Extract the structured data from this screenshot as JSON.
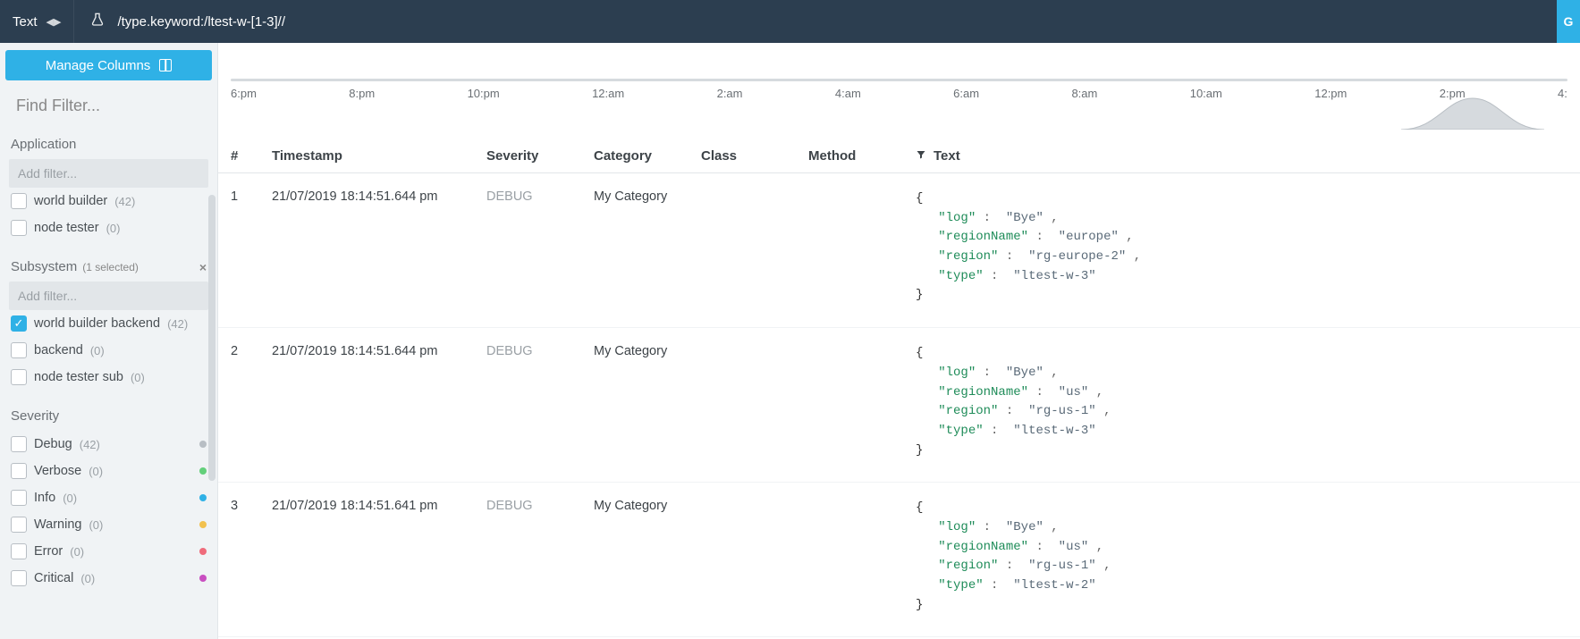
{
  "topbar": {
    "mode_label": "Text",
    "query": "/type.keyword:/ltest-w-[1-3]//",
    "right_btn": "G"
  },
  "sidebar": {
    "manage_columns": "Manage Columns",
    "find_filter_placeholder": "Find Filter...",
    "groups": {
      "application": {
        "title": "Application",
        "add_placeholder": "Add filter...",
        "items": [
          {
            "label": "world builder",
            "count": "(42)",
            "checked": false
          },
          {
            "label": "node tester",
            "count": "(0)",
            "checked": false
          }
        ]
      },
      "subsystem": {
        "title": "Subsystem",
        "selected_note": "(1 selected)",
        "add_placeholder": "Add filter...",
        "items": [
          {
            "label": "world builder backend",
            "count": "(42)",
            "checked": true
          },
          {
            "label": "backend",
            "count": "(0)",
            "checked": false
          },
          {
            "label": "node tester sub",
            "count": "(0)",
            "checked": false
          }
        ]
      },
      "severity": {
        "title": "Severity",
        "items": [
          {
            "label": "Debug",
            "count": "(42)",
            "color": "#b8bec4"
          },
          {
            "label": "Verbose",
            "count": "(0)",
            "color": "#63d07a"
          },
          {
            "label": "Info",
            "count": "(0)",
            "color": "#2fb1e6"
          },
          {
            "label": "Warning",
            "count": "(0)",
            "color": "#f2c14e"
          },
          {
            "label": "Error",
            "count": "(0)",
            "color": "#ef6b7b"
          },
          {
            "label": "Critical",
            "count": "(0)",
            "color": "#c94fc1"
          }
        ]
      }
    }
  },
  "timeline_ticks": [
    "6:pm",
    "8:pm",
    "10:pm",
    "12:am",
    "2:am",
    "4:am",
    "6:am",
    "8:am",
    "10:am",
    "12:pm",
    "2:pm",
    "4:"
  ],
  "columns": {
    "idx": "#",
    "timestamp": "Timestamp",
    "severity": "Severity",
    "category": "Category",
    "class": "Class",
    "method": "Method",
    "text": "Text"
  },
  "rows": [
    {
      "idx": "1",
      "timestamp": "21/07/2019 18:14:51.644 pm",
      "severity": "DEBUG",
      "category": "My Category",
      "json": {
        "log": "Bye",
        "regionName": "europe",
        "region": "rg-europe-2",
        "type": "ltest-w-3"
      }
    },
    {
      "idx": "2",
      "timestamp": "21/07/2019 18:14:51.644 pm",
      "severity": "DEBUG",
      "category": "My Category",
      "json": {
        "log": "Bye",
        "regionName": "us",
        "region": "rg-us-1",
        "type": "ltest-w-3"
      }
    },
    {
      "idx": "3",
      "timestamp": "21/07/2019 18:14:51.641 pm",
      "severity": "DEBUG",
      "category": "My Category",
      "json": {
        "log": "Bye",
        "regionName": "us",
        "region": "rg-us-1",
        "type": "ltest-w-2"
      }
    }
  ]
}
